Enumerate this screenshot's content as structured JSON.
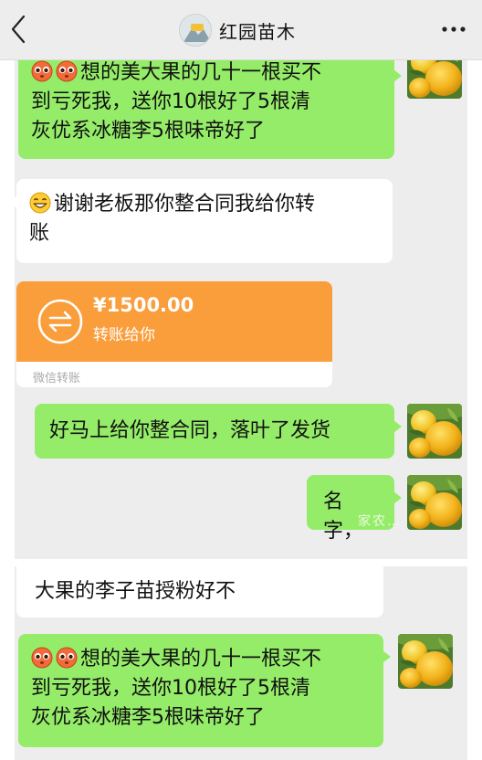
{
  "header": {
    "title": "红园苗木",
    "back_icon": "chevron-left-icon",
    "more_icon": "ellipsis-icon",
    "background": "#ededed"
  },
  "colors": {
    "outgoing_bubble": "#95ec69",
    "incoming_bubble": "#ffffff",
    "chat_background": "#ededed",
    "transfer_orange": "#fa9d3b"
  },
  "messages": [
    {
      "direction": "outgoing",
      "emoji": "pleading-face",
      "text": "想的美大果的几十一根买不到亏死我，送你10根好了5根清灰优系冰糖李5根味帝好了"
    },
    {
      "direction": "incoming",
      "emoji": "grinning-face",
      "text": "谢谢老板那你整合同我给你转账"
    },
    {
      "direction": "incoming",
      "type": "transfer",
      "amount": "¥1500.00",
      "note": "转账给你",
      "footer": "微信转账"
    },
    {
      "direction": "outgoing",
      "text": "好马上给你整合同，落叶了发货"
    },
    {
      "direction": "outgoing",
      "text": "名字，"
    },
    {
      "direction": "incoming",
      "text": "大果的李子苗授粉好不"
    },
    {
      "direction": "outgoing",
      "emoji": "pleading-face",
      "text": "想的美大果的几十一根买不到亏死我，送你10根好了5根清灰优系冰糖李5根味帝好了"
    }
  ],
  "bubbles": {
    "m1_line1": "想的美大果的几十一根买不",
    "m1_line2": "到亏死我，送你10根好了5根清",
    "m1_line3": "灰优系冰糖李5根味帝好了",
    "m2_line1": "谢谢老板那你整合同我给你转",
    "m2_line2": "账",
    "m4": "好马上给你整合同，落叶了发货",
    "m5": "名字，",
    "m6": "大果的李子苗授粉好不",
    "m7_line1": "想的美大果的几十一根买不",
    "m7_line2": "到亏死我，送你10根好了5根清",
    "m7_line3": "灰优系冰糖李5根味帝好了"
  },
  "transfer": {
    "amount": "¥1500.00",
    "note": "转账给你",
    "footer": "微信转账",
    "icon": "transfer-arrows-icon"
  },
  "watermark": "家农…"
}
